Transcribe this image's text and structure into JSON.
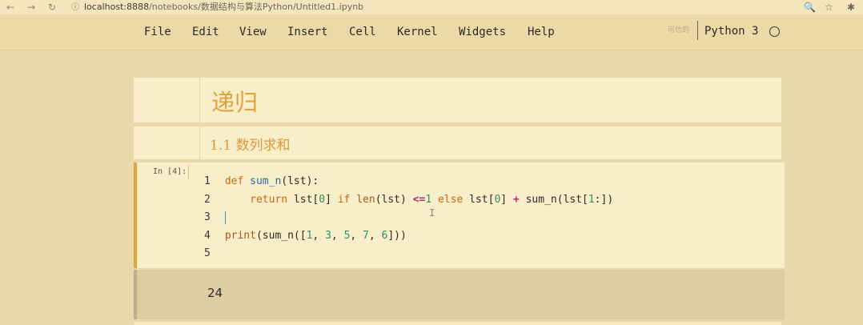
{
  "browser": {
    "url_host": "localhost:8888",
    "url_path": "/notebooks/数据结构与算法Python/Untitled1.ipynb"
  },
  "menubar": {
    "items": [
      "File",
      "Edit",
      "View",
      "Insert",
      "Cell",
      "Kernel",
      "Widgets",
      "Help"
    ],
    "trusted_label": "可信的",
    "kernel_name": "Python 3"
  },
  "cells": {
    "heading1": "递归",
    "heading2": "1.1 数列求和",
    "code_prompt": "In [4]:",
    "output": "24"
  }
}
